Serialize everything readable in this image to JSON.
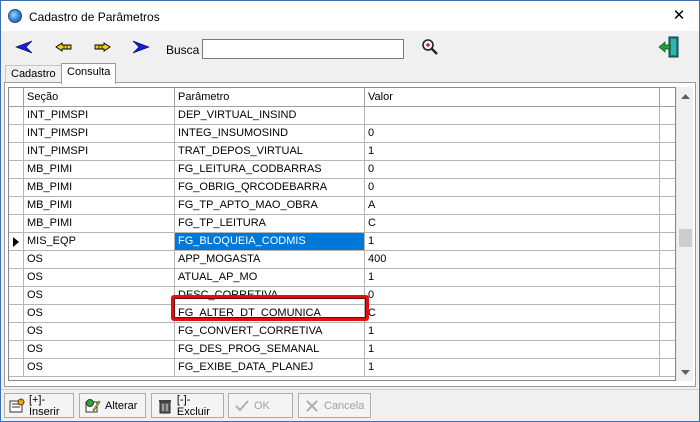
{
  "window": {
    "title": "Cadastro de Parâmetros",
    "close_glyph": "✕"
  },
  "toolbar": {
    "busca_label": "Busca",
    "busca_value": "",
    "icons": [
      "first-record-icon",
      "previous-record-icon",
      "next-record-icon",
      "last-record-icon",
      "search-icon",
      "exit-icon"
    ]
  },
  "tabs": [
    {
      "label": "Cadastro",
      "active": false
    },
    {
      "label": "Consulta",
      "active": true
    }
  ],
  "grid": {
    "columns": [
      "Seção",
      "Parâmetro",
      "Valor"
    ],
    "rows": [
      {
        "secao": "INT_PIMSPI",
        "parametro": "DEP_VIRTUAL_INSIND",
        "valor": ""
      },
      {
        "secao": "INT_PIMSPI",
        "parametro": "INTEG_INSUMOSIND",
        "valor": "0"
      },
      {
        "secao": "INT_PIMSPI",
        "parametro": "TRAT_DEPOS_VIRTUAL",
        "valor": "1"
      },
      {
        "secao": "MB_PIMI",
        "parametro": "FG_LEITURA_CODBARRAS",
        "valor": "0"
      },
      {
        "secao": "MB_PIMI",
        "parametro": "FG_OBRIG_QRCODEBARRA",
        "valor": "0"
      },
      {
        "secao": "MB_PIMI",
        "parametro": "FG_TP_APTO_MAO_OBRA",
        "valor": "A"
      },
      {
        "secao": "MB_PIMI",
        "parametro": "FG_TP_LEITURA",
        "valor": "C"
      },
      {
        "secao": "MIS_EQP",
        "parametro": "FG_BLOQUEIA_CODMIS",
        "valor": "1"
      },
      {
        "secao": "OS",
        "parametro": "APP_MOGASTA",
        "valor": "400"
      },
      {
        "secao": "OS",
        "parametro": "ATUAL_AP_MO",
        "valor": "1"
      },
      {
        "secao": "OS",
        "parametro": "DESC_CORRETIVA",
        "valor": "0"
      },
      {
        "secao": "OS",
        "parametro": "FG_ALTER_DT_COMUNICA",
        "valor": "C"
      },
      {
        "secao": "OS",
        "parametro": "FG_CONVERT_CORRETIVA",
        "valor": "1"
      },
      {
        "secao": "OS",
        "parametro": "FG_DES_PROG_SEMANAL",
        "valor": "1"
      },
      {
        "secao": "OS",
        "parametro": "FG_EXIBE_DATA_PLANEJ",
        "valor": "1"
      }
    ],
    "selected_row": 7
  },
  "bottom": {
    "inserir": "[+]-Inserir",
    "alterar": "Alterar",
    "excluir": "[-]-Excluir",
    "ok": "OK",
    "cancela": "Cancela"
  },
  "colors": {
    "selection": "#0078d7",
    "highlight_box": "#e01010",
    "nav_blue": "#1a1adc",
    "nav_yellow": "#f2d21c"
  }
}
